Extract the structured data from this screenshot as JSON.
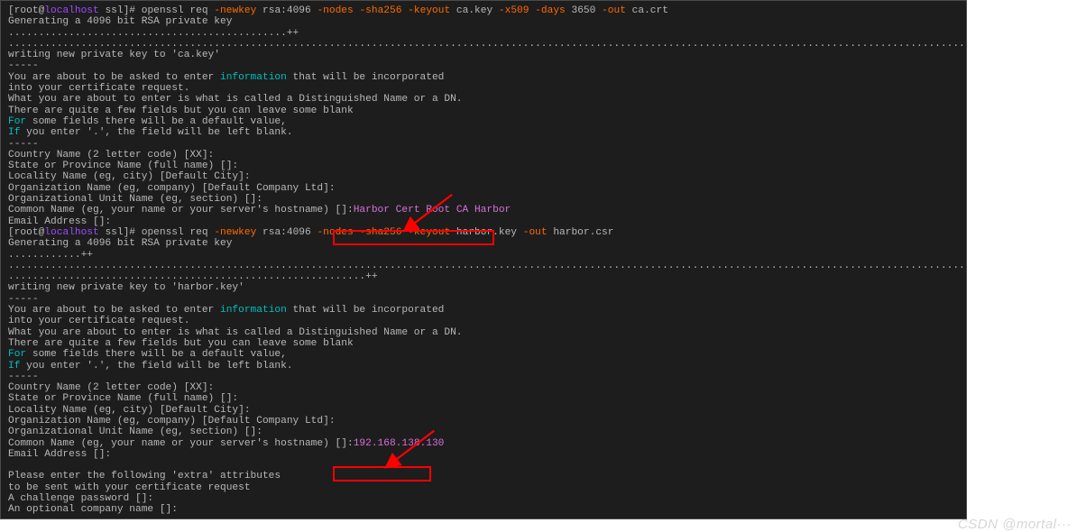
{
  "shell1": {
    "prompt_open": "[root@",
    "host": "localhost",
    "path": " ssl]# ",
    "cmd": "openssl req ",
    "f1": "-newkey",
    "a1": " rsa:4096 ",
    "f2": "-nodes ",
    "f3": "-sha256 ",
    "f4": "-keyout",
    "a4": " ca.key ",
    "f5": "-x509 ",
    "f6": "-days",
    "a6": " 3650 ",
    "f7": "-out",
    "a7": " ca.crt"
  },
  "gen": "Generating a 4096 bit RSA private key",
  "dots1": "..............................................++",
  "dots2": ".....................................................................................................................................................................................++",
  "write1": "writing new private key to 'ca.key'",
  "sep": "-----",
  "about1": "You are about to be asked to enter ",
  "info": "information",
  "about2": " that will be incorporated",
  "into": "into your certificate request.",
  "what": "What you are about to enter is what is called a Distinguished Name or a DN.",
  "quite": "There are quite a few fields but you can leave some blank",
  "for": "For",
  "for_rest": " some fields there will be a default value,",
  "if": "If",
  "if_rest": " you enter '.', the field will be left blank.",
  "cn": "Country Name (2 letter code) [XX]:",
  "sp": "State or Province Name (full name) []:",
  "lc": "Locality Name (eg, city) [Default City]:",
  "on": "Organization Name (eg, company) [Default Company Ltd]:",
  "ou": "Organizational Unit Name (eg, section) []:",
  "cm": "Common Name (eg, your name or your server's hostname) []:",
  "cm_val1": "Harbor Cert Root CA Harbor",
  "em": "Email Address []:",
  "shell2": {
    "prompt_open": "[root@",
    "host": "localhost",
    "path": " ssl]# ",
    "cmd": "openssl req ",
    "f1": "-newkey",
    "a1": " rsa:4096 ",
    "f2": "-nodes ",
    "f3": "-sha256 ",
    "f4": "-keyout",
    "a4": " harbor.key ",
    "f5": "-out",
    "a5": " harbor.csr"
  },
  "dots3": "............++",
  "dots4": ".....................................................................................................................................................................................++",
  "dots5": "...........................................................++",
  "write2": "writing new private key to 'harbor.key'",
  "cm_val2": "192.168.138.130",
  "extra_hdr": "Please enter the following 'extra' attributes",
  "extra_sent": "to be sent with your certificate request",
  "chal": "A challenge password []:",
  "optc": "An optional company name []:",
  "watermark": "CSDN @mortal···"
}
